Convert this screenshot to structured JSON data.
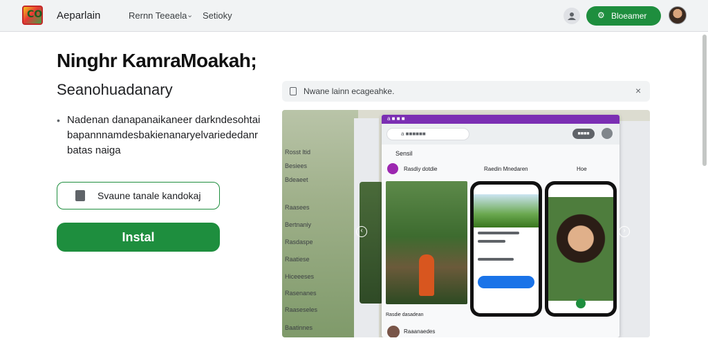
{
  "header": {
    "logo_text": "CO",
    "app_title": "Aeparlain",
    "nav": [
      "Rernn Teeaela",
      "Setioky"
    ],
    "primary_action": "Bloeamer",
    "primary_icon": "puzzle-icon"
  },
  "hero": {
    "title": "Ninghr KamraMoakah;",
    "subtitle": "Seanohuadanary",
    "bullet": "Nadenan danapanaikaneer darkndesohtai bapannnamdesbakienanaryelvariededanr batas naiga",
    "secondary_button": "Svaune tanale kandokaj",
    "install_button": "Instal"
  },
  "notice": {
    "text": "Nwane lainn ecageahke.",
    "close": "×"
  },
  "showcase": {
    "window_bar": "a ■ ■ ■",
    "search_placeholder": "a ■■■■■■",
    "window_button": "■■■■",
    "section_title": "Sensil",
    "row_labels": [
      "Rasdiy dotdie",
      "Raedin Mnedaren",
      "Hoe"
    ],
    "side_labels": [
      "Rosst ltid",
      "Besiees",
      "Bdeaeet",
      "Raasees",
      "Bertnaniy",
      "Rasdaspe",
      "Raatiese",
      "Hiceeeses",
      "Rasenanes",
      "Raaseseles",
      "Baatinnes"
    ],
    "caption": "Rasdie dasadean",
    "bottom_label": "Raaanaedes"
  },
  "colors": {
    "accent": "#1e8e3e",
    "window_accent": "#7b2fb3"
  }
}
